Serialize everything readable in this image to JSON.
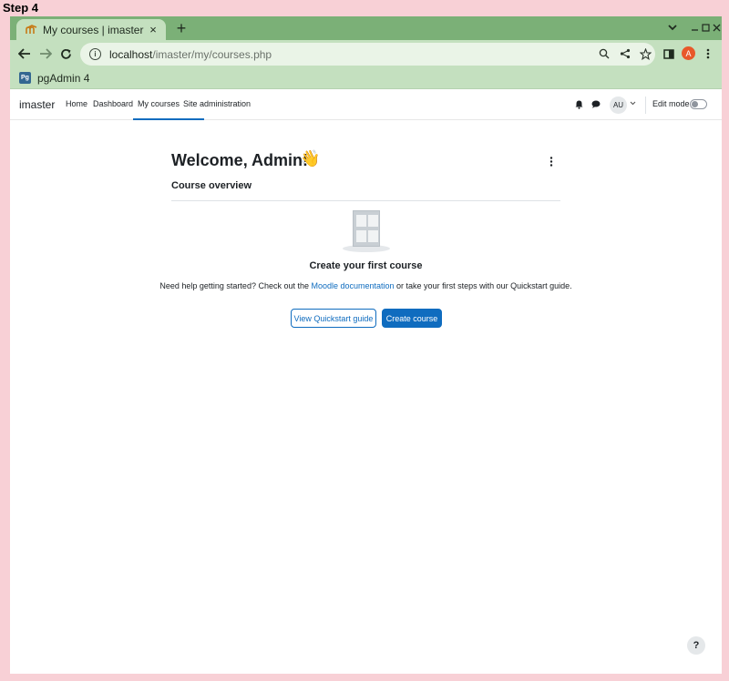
{
  "step_label": "Step 4",
  "browser": {
    "tab_title": "My courses | imaster",
    "tab_close": "×",
    "new_tab": "+",
    "url_host": "localhost",
    "url_path": "/imaster/my/courses.php",
    "profile_initial": "A",
    "bookmark_icon_text": "Pg",
    "bookmark_label": "pgAdmin 4"
  },
  "navbar": {
    "brand": "imaster",
    "links": [
      "Home",
      "Dashboard",
      "My courses",
      "Site administration"
    ],
    "active_link": "My courses",
    "avatar": "AU",
    "edit_mode_label": "Edit mode",
    "edit_mode_on": false
  },
  "main": {
    "welcome": "Welcome, Admin!",
    "wave": "👋",
    "course_overview": "Course overview",
    "empty_title": "Create your first course",
    "help_prefix": "Need help getting started? Check out the ",
    "help_link": "Moodle documentation",
    "help_suffix": " or take your first steps with our Quickstart guide.",
    "btn_quickstart": "View Quickstart guide",
    "btn_create": "Create course"
  },
  "help_fab": "?",
  "colors": {
    "page_bg": "#f8d0d6",
    "tabstrip": "#7bb077",
    "toolbar": "#c4e0bf",
    "moodle_primary": "#0f6cbf"
  }
}
